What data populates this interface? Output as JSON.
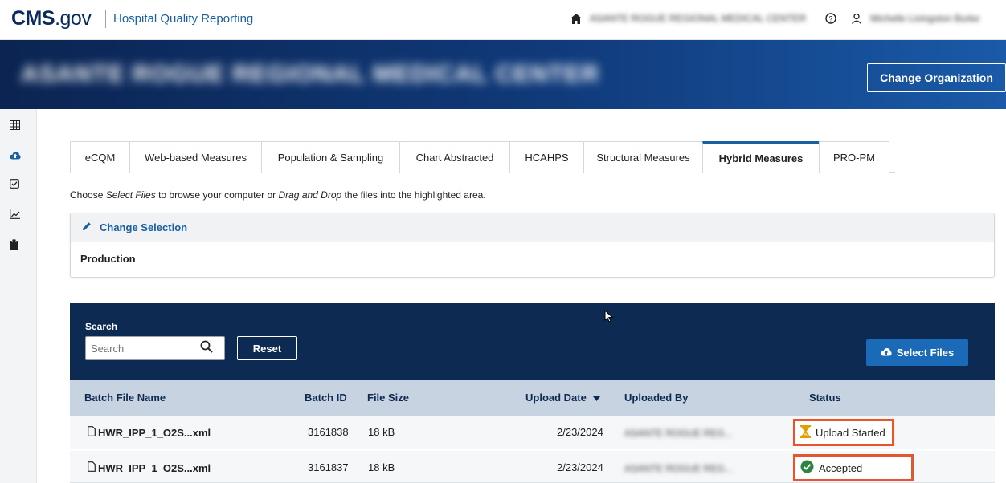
{
  "header": {
    "logo_cms": "CMS",
    "logo_gov": ".gov",
    "app_name": "Hospital Quality Reporting",
    "org_name_blurred": "ASANTE ROGUE REGIONAL MEDICAL CENTER",
    "user_name_blurred": "Michelle Livingston Burke"
  },
  "banner": {
    "org_title_blurred": "ASANTE ROGUE REGIONAL MEDICAL CENTER",
    "change_org_label": "Change Organization"
  },
  "rail": {
    "items": [
      {
        "icon": "grid-icon"
      },
      {
        "icon": "cloud-upload-icon"
      },
      {
        "icon": "checkbox-icon"
      },
      {
        "icon": "line-chart-icon"
      },
      {
        "icon": "clipboard-icon"
      }
    ]
  },
  "tabs": [
    {
      "label": "eCQM",
      "active": false
    },
    {
      "label": "Web-based Measures",
      "active": false
    },
    {
      "label": "Population & Sampling",
      "active": false
    },
    {
      "label": "Chart Abstracted",
      "active": false
    },
    {
      "label": "HCAHPS",
      "active": false
    },
    {
      "label": "Structural Measures",
      "active": false
    },
    {
      "label": "Hybrid Measures",
      "active": true
    },
    {
      "label": "PRO-PM",
      "active": false
    }
  ],
  "instructions": {
    "part1": "Choose ",
    "select_files": "Select Files",
    "part2": " to browse your computer or ",
    "drag_drop": "Drag and Drop",
    "part3": " the files into the highlighted area."
  },
  "selection": {
    "change_label": "Change Selection",
    "value": "Production"
  },
  "search": {
    "label": "Search",
    "placeholder": "Search",
    "reset_label": "Reset",
    "select_files_label": "Select Files"
  },
  "table": {
    "headers": {
      "batch_file_name": "Batch File Name",
      "batch_id": "Batch ID",
      "file_size": "File Size",
      "upload_date": "Upload Date",
      "uploaded_by": "Uploaded By",
      "status": "Status"
    },
    "rows": [
      {
        "file_name": "HWR_IPP_1_O2S...xml",
        "batch_id": "3161838",
        "file_size": "18 kB",
        "upload_date": "2/23/2024",
        "uploaded_by": "ASANTE ROGUE REG...",
        "status": "Upload Started",
        "status_icon": "hourglass-icon"
      },
      {
        "file_name": "HWR_IPP_1_O2S...xml",
        "batch_id": "3161837",
        "file_size": "18 kB",
        "upload_date": "2/23/2024",
        "uploaded_by": "ASANTE ROGUE REG...",
        "status": "Accepted",
        "status_icon": "check-circle-icon"
      }
    ]
  },
  "colors": {
    "brand_navy": "#0d2a52",
    "link_blue": "#1a5fa0",
    "highlight_red": "#e4572e",
    "accepted_green": "#2e8540",
    "pending_amber": "#e0a100"
  }
}
